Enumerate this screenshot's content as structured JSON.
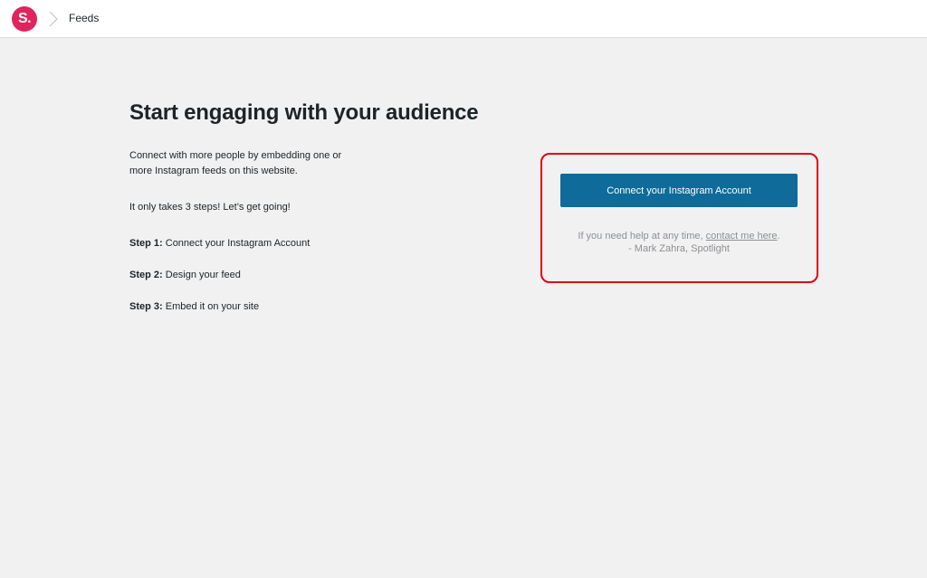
{
  "header": {
    "logo_text": "S.",
    "breadcrumb": "Feeds",
    "logo_color": "#e0245e"
  },
  "main": {
    "heading": "Start engaging with your audience",
    "intro": "Connect with more people by embedding one or more Instagram feeds on this website.",
    "takes": "It only takes 3 steps! Let’s get going!",
    "steps": [
      {
        "label": "Step 1:",
        "text": "Connect your Instagram Account"
      },
      {
        "label": "Step 2:",
        "text": "Design your feed"
      },
      {
        "label": "Step 3:",
        "text": "Embed it on your site"
      }
    ]
  },
  "connect": {
    "button_label": "Connect your Instagram Account",
    "button_color": "#0e6b9a",
    "help_prefix": "If you need help at any time,",
    "help_link": "contact me here",
    "help_suffix": ".",
    "signature": "- Mark Zahra, Spotlight",
    "highlight_color": "#e3000f"
  }
}
